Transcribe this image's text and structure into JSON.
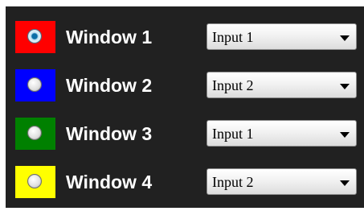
{
  "windows": [
    {
      "label": "Window 1",
      "color": "#ff0000",
      "selected": true,
      "input_value": "Input 1"
    },
    {
      "label": "Window 2",
      "color": "#0000ff",
      "selected": false,
      "input_value": "Input 2"
    },
    {
      "label": "Window 3",
      "color": "#008000",
      "selected": false,
      "input_value": "Input 1"
    },
    {
      "label": "Window 4",
      "color": "#ffff00",
      "selected": false,
      "input_value": "Input 2"
    }
  ],
  "icons": {
    "radio_icon": "radio-button-icon",
    "dropdown_icon": "chevron-down-icon"
  }
}
